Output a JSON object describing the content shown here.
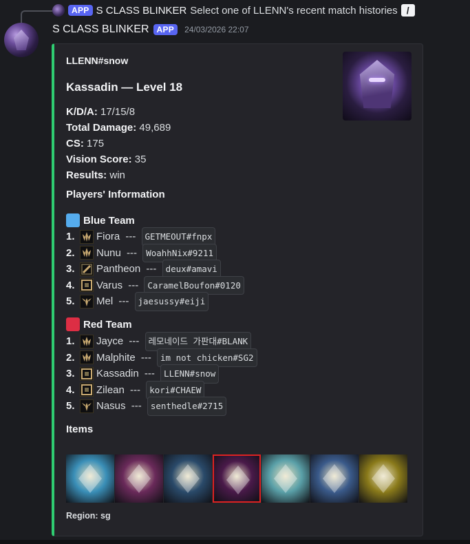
{
  "reply": {
    "app_name": "S CLASS BLINKER",
    "badge": "APP",
    "text": "Select one of LLENN's recent match histories"
  },
  "message": {
    "author": "S CLASS BLINKER",
    "badge": "APP",
    "timestamp": "24/03/2026 22:07"
  },
  "embed": {
    "accent_color": "#2fcc71",
    "author": "LLENN#snow",
    "title": "Kassadin — Level 18",
    "stats": [
      {
        "label": "K/D/A:",
        "value": "17/15/8"
      },
      {
        "label": "Total Damage:",
        "value": "49,689"
      },
      {
        "label": "CS:",
        "value": "175"
      },
      {
        "label": "Vision Score:",
        "value": "35"
      },
      {
        "label": "Results:",
        "value": "win"
      }
    ],
    "players_heading": "Players' Information",
    "blue_team": {
      "name": "Blue Team",
      "color": "#55acee",
      "players": [
        {
          "num": "1.",
          "role_icon": "top-role-icon",
          "champion": "Fiora",
          "sep": " --- ",
          "riot_id": "GETMEOUT#fnpx"
        },
        {
          "num": "2.",
          "role_icon": "top-role-icon",
          "champion": "Nunu",
          "sep": " --- ",
          "riot_id": "WoahhNix#9211"
        },
        {
          "num": "3.",
          "role_icon": "jungle-role-icon",
          "champion": "Pantheon",
          "sep": " --- ",
          "riot_id": "deux#amavi"
        },
        {
          "num": "4.",
          "role_icon": "mid-role-icon",
          "champion": "Varus",
          "sep": " --- ",
          "riot_id": "CaramelBoufon#0120"
        },
        {
          "num": "5.",
          "role_icon": "support-role-icon",
          "champion": "Mel",
          "sep": " --- ",
          "riot_id": "jaesussy#eiji"
        }
      ]
    },
    "red_team": {
      "name": "Red Team",
      "color": "#dd2e44",
      "players": [
        {
          "num": "1.",
          "role_icon": "top-role-icon",
          "champion": "Jayce",
          "sep": " --- ",
          "riot_id": "레모네이드 가판대#BLANK"
        },
        {
          "num": "2.",
          "role_icon": "top-role-icon",
          "champion": "Malphite",
          "sep": " --- ",
          "riot_id": "im not chicken#SG2"
        },
        {
          "num": "3.",
          "role_icon": "mid-role-icon",
          "champion": "Kassadin",
          "sep": " --- ",
          "riot_id": "LLENN#snow"
        },
        {
          "num": "4.",
          "role_icon": "mid-role-icon",
          "champion": "Zilean",
          "sep": " --- ",
          "riot_id": "kori#CHAEW"
        },
        {
          "num": "5.",
          "role_icon": "support-role-icon",
          "champion": "Nasus",
          "sep": " --- ",
          "riot_id": "senthedle#2715"
        }
      ]
    },
    "items_heading": "Items",
    "items": [
      {
        "icon": "item-1-icon",
        "color": "#3a8fb8"
      },
      {
        "icon": "item-2-icon",
        "color": "#6a2a5a"
      },
      {
        "icon": "item-3-icon",
        "color": "#2a4a6a"
      },
      {
        "icon": "item-4-icon",
        "color": "#4a1a4a"
      },
      {
        "icon": "item-5-icon",
        "color": "#5aa0a8"
      },
      {
        "icon": "item-6-icon",
        "color": "#3a5a8a"
      },
      {
        "icon": "item-7-icon",
        "color": "#8a7a1a"
      }
    ],
    "footer": "Region: sg"
  }
}
